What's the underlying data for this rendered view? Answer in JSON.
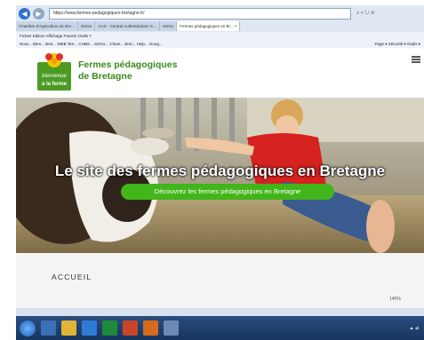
{
  "browser": {
    "url": "https://www.fermes-pedagogiques-bretagne.fr/",
    "tabs": [
      {
        "label": "Chambre d'Agriculture de Bre...",
        "active": false
      },
      {
        "label": "SOGo",
        "active": false
      },
      {
        "label": "CAS - Central Authentication S...",
        "active": false
      },
      {
        "label": "SOGo",
        "active": false
      },
      {
        "label": "Fermes pédagogiques en Br... ×",
        "active": true
      }
    ],
    "menu": "Fichier   Edition   Affichage   Favoris   Outils   ?",
    "favorites": "Nouv...   Bien...   Bret...   WEB   Terr...   CHBS...   SOGo...   Cham...   Bret...   Help...   Goog...",
    "toolbar": "Page ▾   Sécurité ▾   Outils ▾"
  },
  "site": {
    "logo_text_top": "bienvenue",
    "logo_text_bottom": "à la ferme",
    "title_line1": "Fermes pédagogiques",
    "title_line2": "de Bretagne",
    "hero_title": "Le site des fermes pédagogiques en Bretagne",
    "hero_button": "Découvrez les fermes pédagogiques en Bretagne",
    "section_title": "ACCUEIL",
    "zoom": "140%"
  },
  "colors": {
    "brand_green": "#3a8a1e",
    "button_green": "#42b51b"
  }
}
